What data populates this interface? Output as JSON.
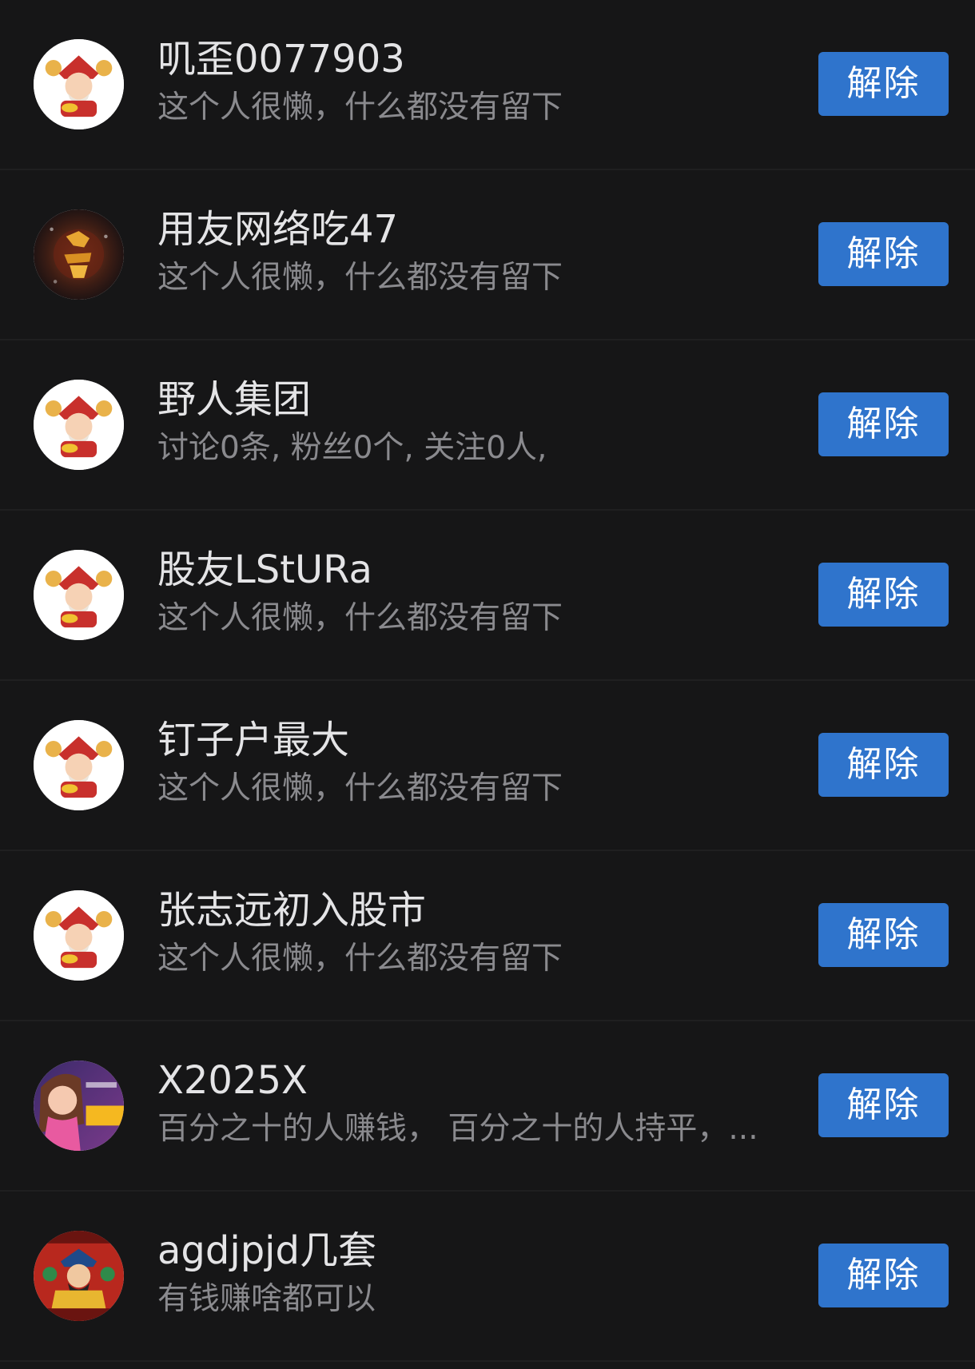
{
  "colors": {
    "background": "#161617",
    "divider": "#1f1f20",
    "name_text": "#e4e4e6",
    "desc_text": "#8a8a8e",
    "button": "#2f74cc",
    "button_text": "#ffffff"
  },
  "rows": [
    {
      "name": "叽歪0077903",
      "desc": "这个人很懒，什么都没有留下",
      "action": "解除",
      "avatar": "caishen-avatar-icon"
    },
    {
      "name": "用友网络吃47",
      "desc": "这个人很懒，什么都没有留下",
      "action": "解除",
      "avatar": "zhaocai-avatar-icon"
    },
    {
      "name": "野人集团",
      "desc": "讨论0条, 粉丝0个, 关注0人,",
      "action": "解除",
      "avatar": "caishen-avatar-icon"
    },
    {
      "name": "股友LStURa",
      "desc": "这个人很懒，什么都没有留下",
      "action": "解除",
      "avatar": "caishen-avatar-icon"
    },
    {
      "name": "钉子户最大",
      "desc": "这个人很懒，什么都没有留下",
      "action": "解除",
      "avatar": "caishen-avatar-icon"
    },
    {
      "name": "张志远初入股市",
      "desc": "这个人很懒，什么都没有留下",
      "action": "解除",
      "avatar": "caishen-avatar-icon"
    },
    {
      "name": "X2025X",
      "desc": "百分之十的人赚钱， 百分之十的人持平，...",
      "action": "解除",
      "avatar": "game-girl-avatar-icon"
    },
    {
      "name": "agdjpjd几套",
      "desc": "有钱赚啥都可以",
      "action": "解除",
      "avatar": "fortune-god-avatar-icon"
    }
  ]
}
